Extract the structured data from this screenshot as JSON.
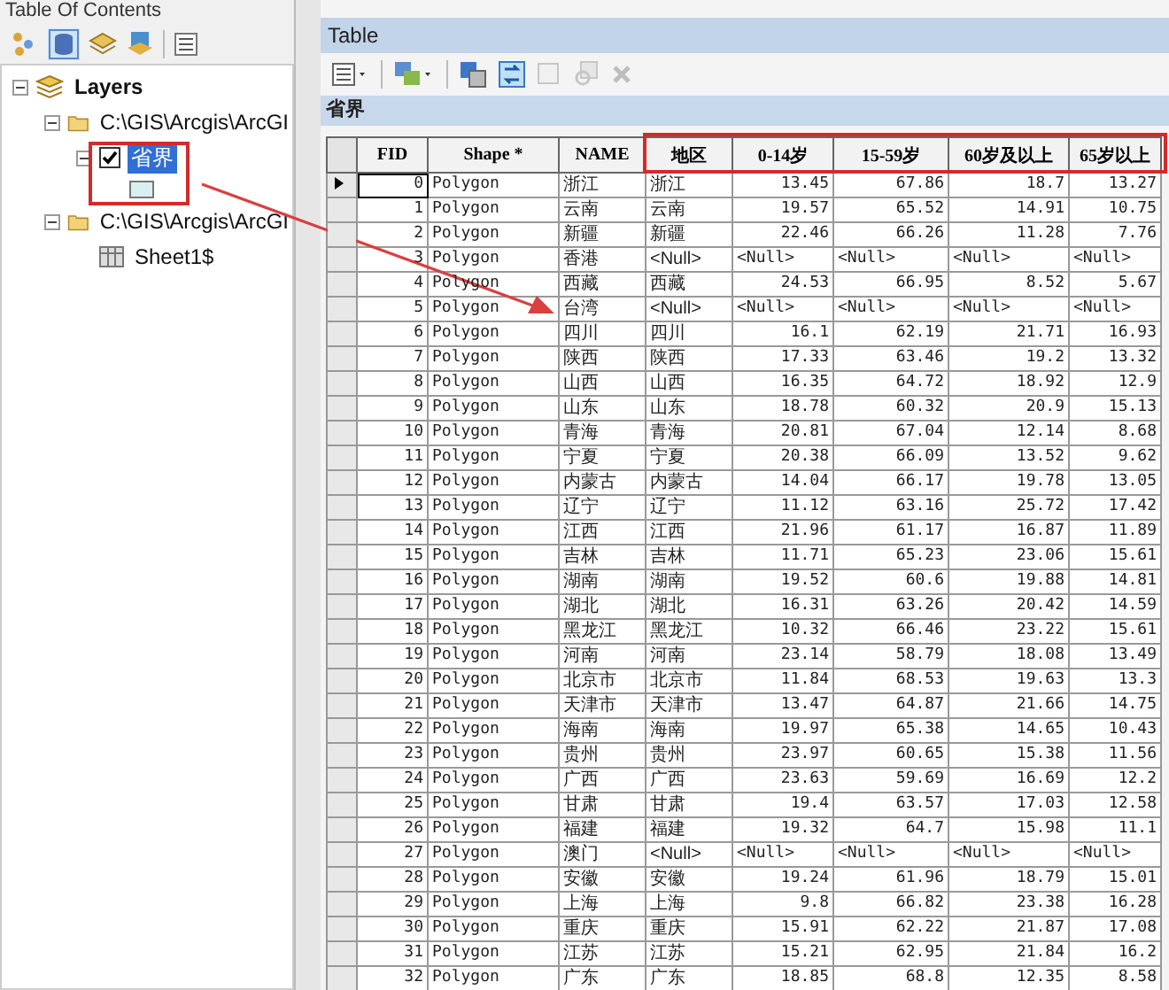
{
  "toc": {
    "title": "Table Of Contents",
    "tree": [
      {
        "kind": "group",
        "label": "Layers",
        "expanded": true,
        "children": [
          {
            "kind": "folder",
            "label": "C:\\GIS\\Arcgis\\ArcGI",
            "expanded": true,
            "children": [
              {
                "kind": "layer",
                "label": "省界",
                "checked": true,
                "selected": true,
                "expanded": true
              }
            ]
          },
          {
            "kind": "folder",
            "label": "C:\\GIS\\Arcgis\\ArcGI",
            "expanded": true,
            "children": [
              {
                "kind": "table",
                "label": "Sheet1$"
              }
            ]
          }
        ]
      }
    ]
  },
  "table": {
    "title": "Table",
    "layer_name": "省界",
    "columns": [
      {
        "label": "FID",
        "kind": "number"
      },
      {
        "label": "Shape *",
        "kind": "text"
      },
      {
        "label": "NAME",
        "kind": "text"
      },
      {
        "label": "地区",
        "kind": "text"
      },
      {
        "label": "0-14岁",
        "kind": "number"
      },
      {
        "label": "15-59岁",
        "kind": "number"
      },
      {
        "label": "60岁及以上",
        "kind": "number"
      },
      {
        "label": "65岁以上",
        "kind": "number"
      }
    ],
    "rows": [
      {
        "current": true,
        "cells": [
          "0",
          "Polygon",
          "浙江",
          "浙江",
          "13.45",
          "67.86",
          "18.7",
          "13.27"
        ]
      },
      {
        "current": false,
        "cells": [
          "1",
          "Polygon",
          "云南",
          "云南",
          "19.57",
          "65.52",
          "14.91",
          "10.75"
        ]
      },
      {
        "current": false,
        "cells": [
          "2",
          "Polygon",
          "新疆",
          "新疆",
          "22.46",
          "66.26",
          "11.28",
          "7.76"
        ]
      },
      {
        "current": false,
        "cells": [
          "3",
          "Polygon",
          "香港",
          "<Null>",
          "<Null>",
          "<Null>",
          "<Null>",
          "<Null>"
        ]
      },
      {
        "current": false,
        "cells": [
          "4",
          "Polygon",
          "西藏",
          "西藏",
          "24.53",
          "66.95",
          "8.52",
          "5.67"
        ]
      },
      {
        "current": false,
        "cells": [
          "5",
          "Polygon",
          "台湾",
          "<Null>",
          "<Null>",
          "<Null>",
          "<Null>",
          "<Null>"
        ]
      },
      {
        "current": false,
        "cells": [
          "6",
          "Polygon",
          "四川",
          "四川",
          "16.1",
          "62.19",
          "21.71",
          "16.93"
        ]
      },
      {
        "current": false,
        "cells": [
          "7",
          "Polygon",
          "陕西",
          "陕西",
          "17.33",
          "63.46",
          "19.2",
          "13.32"
        ]
      },
      {
        "current": false,
        "cells": [
          "8",
          "Polygon",
          "山西",
          "山西",
          "16.35",
          "64.72",
          "18.92",
          "12.9"
        ]
      },
      {
        "current": false,
        "cells": [
          "9",
          "Polygon",
          "山东",
          "山东",
          "18.78",
          "60.32",
          "20.9",
          "15.13"
        ]
      },
      {
        "current": false,
        "cells": [
          "10",
          "Polygon",
          "青海",
          "青海",
          "20.81",
          "67.04",
          "12.14",
          "8.68"
        ]
      },
      {
        "current": false,
        "cells": [
          "11",
          "Polygon",
          "宁夏",
          "宁夏",
          "20.38",
          "66.09",
          "13.52",
          "9.62"
        ]
      },
      {
        "current": false,
        "cells": [
          "12",
          "Polygon",
          "内蒙古",
          "内蒙古",
          "14.04",
          "66.17",
          "19.78",
          "13.05"
        ]
      },
      {
        "current": false,
        "cells": [
          "13",
          "Polygon",
          "辽宁",
          "辽宁",
          "11.12",
          "63.16",
          "25.72",
          "17.42"
        ]
      },
      {
        "current": false,
        "cells": [
          "14",
          "Polygon",
          "江西",
          "江西",
          "21.96",
          "61.17",
          "16.87",
          "11.89"
        ]
      },
      {
        "current": false,
        "cells": [
          "15",
          "Polygon",
          "吉林",
          "吉林",
          "11.71",
          "65.23",
          "23.06",
          "15.61"
        ]
      },
      {
        "current": false,
        "cells": [
          "16",
          "Polygon",
          "湖南",
          "湖南",
          "19.52",
          "60.6",
          "19.88",
          "14.81"
        ]
      },
      {
        "current": false,
        "cells": [
          "17",
          "Polygon",
          "湖北",
          "湖北",
          "16.31",
          "63.26",
          "20.42",
          "14.59"
        ]
      },
      {
        "current": false,
        "cells": [
          "18",
          "Polygon",
          "黑龙江",
          "黑龙江",
          "10.32",
          "66.46",
          "23.22",
          "15.61"
        ]
      },
      {
        "current": false,
        "cells": [
          "19",
          "Polygon",
          "河南",
          "河南",
          "23.14",
          "58.79",
          "18.08",
          "13.49"
        ]
      },
      {
        "current": false,
        "cells": [
          "20",
          "Polygon",
          "北京市",
          "北京市",
          "11.84",
          "68.53",
          "19.63",
          "13.3"
        ]
      },
      {
        "current": false,
        "cells": [
          "21",
          "Polygon",
          "天津市",
          "天津市",
          "13.47",
          "64.87",
          "21.66",
          "14.75"
        ]
      },
      {
        "current": false,
        "cells": [
          "22",
          "Polygon",
          "海南",
          "海南",
          "19.97",
          "65.38",
          "14.65",
          "10.43"
        ]
      },
      {
        "current": false,
        "cells": [
          "23",
          "Polygon",
          "贵州",
          "贵州",
          "23.97",
          "60.65",
          "15.38",
          "11.56"
        ]
      },
      {
        "current": false,
        "cells": [
          "24",
          "Polygon",
          "广西",
          "广西",
          "23.63",
          "59.69",
          "16.69",
          "12.2"
        ]
      },
      {
        "current": false,
        "cells": [
          "25",
          "Polygon",
          "甘肃",
          "甘肃",
          "19.4",
          "63.57",
          "17.03",
          "12.58"
        ]
      },
      {
        "current": false,
        "cells": [
          "26",
          "Polygon",
          "福建",
          "福建",
          "19.32",
          "64.7",
          "15.98",
          "11.1"
        ]
      },
      {
        "current": false,
        "cells": [
          "27",
          "Polygon",
          "澳门",
          "<Null>",
          "<Null>",
          "<Null>",
          "<Null>",
          "<Null>"
        ]
      },
      {
        "current": false,
        "cells": [
          "28",
          "Polygon",
          "安徽",
          "安徽",
          "19.24",
          "61.96",
          "18.79",
          "15.01"
        ]
      },
      {
        "current": false,
        "cells": [
          "29",
          "Polygon",
          "上海",
          "上海",
          "9.8",
          "66.82",
          "23.38",
          "16.28"
        ]
      },
      {
        "current": false,
        "cells": [
          "30",
          "Polygon",
          "重庆",
          "重庆",
          "15.91",
          "62.22",
          "21.87",
          "17.08"
        ]
      },
      {
        "current": false,
        "cells": [
          "31",
          "Polygon",
          "江苏",
          "江苏",
          "15.21",
          "62.95",
          "21.84",
          "16.2"
        ]
      },
      {
        "current": false,
        "cells": [
          "32",
          "Polygon",
          "广东",
          "广东",
          "18.85",
          "68.8",
          "12.35",
          "8.58"
        ]
      }
    ]
  }
}
